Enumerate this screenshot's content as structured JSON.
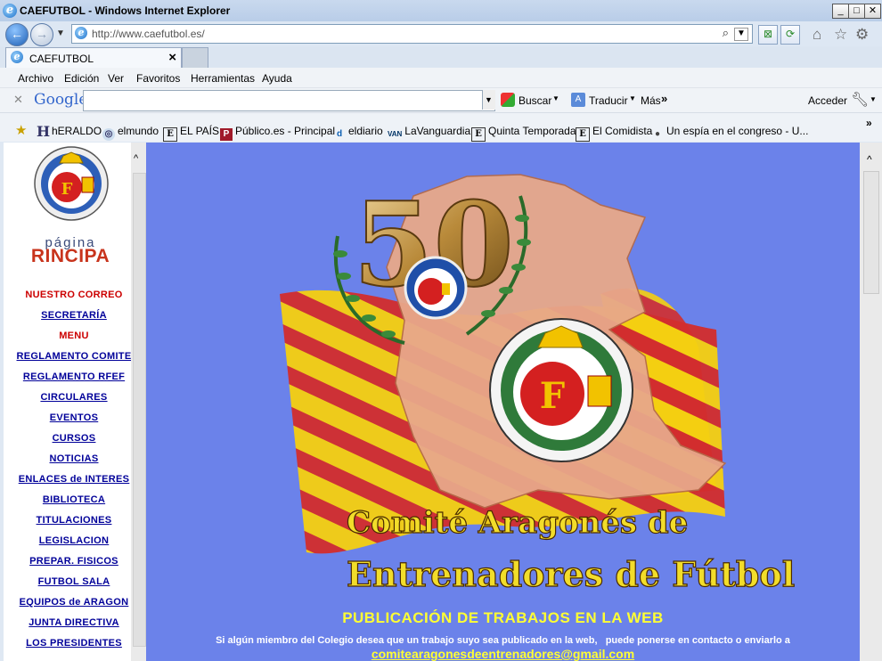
{
  "window": {
    "title": "CAEFUTBOL - Windows Internet Explorer"
  },
  "address": {
    "url": "http://www.caefutbol.es/"
  },
  "tab": {
    "label": "CAEFUTBOL"
  },
  "menu": [
    "Archivo",
    "Edición",
    "Ver",
    "Favoritos",
    "Herramientas",
    "Ayuda"
  ],
  "googlebar": {
    "logo": "Google",
    "search_label": "Buscar",
    "translate_label": "Traducir",
    "more_label": "Más",
    "signin_label": "Acceder"
  },
  "favorites": [
    {
      "icon": "H",
      "label": "hERALDO"
    },
    {
      "icon": "◎",
      "label": "elmundo"
    },
    {
      "icon": "E",
      "label": "EL PAÍS"
    },
    {
      "icon": "P",
      "label": "Público.es - Principal"
    },
    {
      "icon": "d",
      "label": "eldiario"
    },
    {
      "icon": "VAN",
      "label": "LaVanguardia"
    },
    {
      "icon": "E",
      "label": "Quinta Temporada"
    },
    {
      "icon": "E",
      "label": "El Comidista"
    },
    {
      "icon": "●",
      "label": "Un espía en el congreso - U..."
    }
  ],
  "sidebar": {
    "page_label_top": "página",
    "page_label_main": "RINCIPA",
    "links": [
      {
        "label": "NUESTRO CORREO",
        "style": "red"
      },
      {
        "label": "SECRETARÍA",
        "style": "link"
      },
      {
        "label": "MENU",
        "style": "red"
      },
      {
        "label": "REGLAMENTO COMITE",
        "style": "link"
      },
      {
        "label": "REGLAMENTO RFEF",
        "style": "link"
      },
      {
        "label": "CIRCULARES",
        "style": "link"
      },
      {
        "label": "EVENTOS",
        "style": "link"
      },
      {
        "label": "CURSOS",
        "style": "link"
      },
      {
        "label": "NOTICIAS",
        "style": "link"
      },
      {
        "label": "ENLACES de INTERES",
        "style": "link"
      },
      {
        "label": "BIBLIOTECA",
        "style": "link"
      },
      {
        "label": "TITULACIONES",
        "style": "link"
      },
      {
        "label": "LEGISLACION",
        "style": "link"
      },
      {
        "label": "PREPAR. FISICOS",
        "style": "link"
      },
      {
        "label": "FUTBOL SALA",
        "style": "link"
      },
      {
        "label": "EQUIPOS de ARAGON",
        "style": "link"
      },
      {
        "label": "JUNTA DIRECTIVA",
        "style": "link"
      },
      {
        "label": "LOS PRESIDENTES",
        "style": "link"
      }
    ]
  },
  "hero": {
    "number": "50",
    "badge_text": "ENTRENADOR",
    "title_line1": "Comité Aragonés de",
    "title_line2": "Entrenadores de Fútbol",
    "publication_heading": "PUBLICACIÓN DE TRABAJOS EN LA WEB",
    "publication_text": "Si algún miembro del Colegio desea que un trabajo suyo sea publicado en la web,   puede ponerse en contacto o enviarlo a",
    "email": "comitearagonesdeentrenadores@gmail.com"
  },
  "colors": {
    "page_bg": "#6b82ea",
    "link": "#000099",
    "accent_red": "#cc0000",
    "heading_yellow": "#ffff33"
  }
}
